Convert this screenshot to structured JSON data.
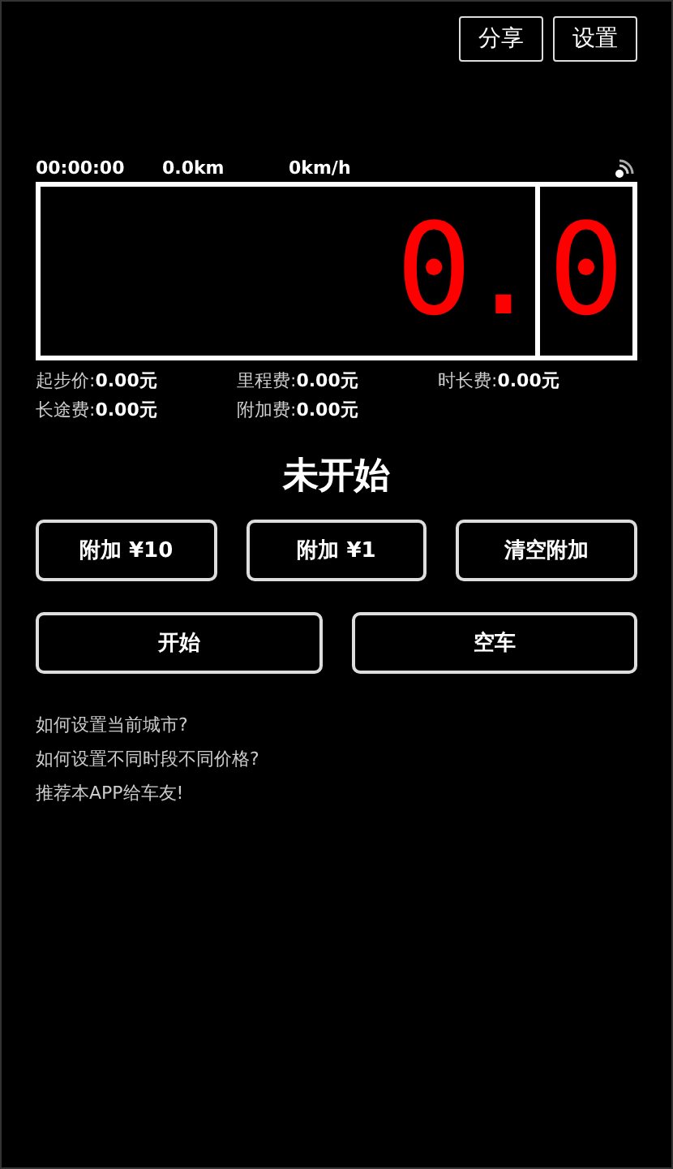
{
  "top_buttons": [
    "分享",
    "设置"
  ],
  "stats": {
    "time": "00:00:00",
    "distance": "0.0km",
    "speed": "0km/h"
  },
  "display": {
    "main": "0.",
    "tenths": "0"
  },
  "fees": [
    {
      "text": "起步价:**0.00元**"
    },
    {
      "text": "里程费:**0.00元**"
    },
    {
      "text": "时长费:**0.00元**"
    },
    {
      "text": "长途费:**0.00元**"
    },
    {
      "text": "附加费:**0.00元**"
    }
  ],
  "status": "未开始",
  "extra_buttons": [
    "附加 ¥10",
    "附加 ¥1",
    "清空附加"
  ],
  "main_buttons": [
    "开始",
    "空车"
  ],
  "links": [
    "如何设置当前城市?",
    "如何设置不同时段不同价格?",
    "推荐本APP给车友!"
  ]
}
